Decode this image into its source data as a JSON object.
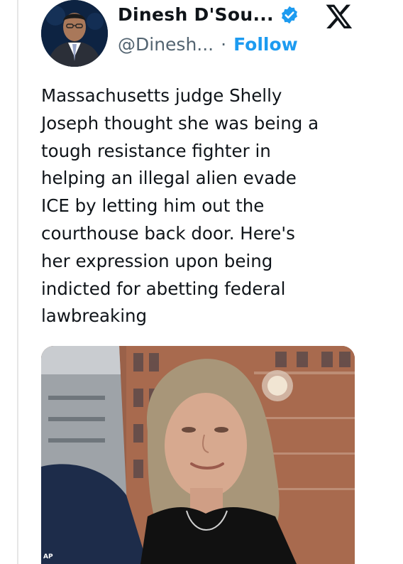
{
  "author": {
    "display_name": "Dinesh D'Sou...",
    "handle": "@Dinesh...",
    "separator": "·",
    "follow_label": "Follow",
    "verified": true
  },
  "icons": {
    "avatar": "profile-photo",
    "verified": "verified-badge-icon",
    "platform": "x-logo-icon"
  },
  "tweet": {
    "text": "Massachusetts judge Shelly\nJoseph thought she was being a\ntough resistance fighter in\nhelping an illegal alien evade\nICE by letting him out the\ncourthouse back door. Here's\nher expression upon being\nindicted for abetting federal\nlawbreaking"
  },
  "media": {
    "credit": "AP"
  },
  "colors": {
    "accent": "#1d9bf0",
    "text": "#0f1419",
    "secondary": "#536471"
  }
}
